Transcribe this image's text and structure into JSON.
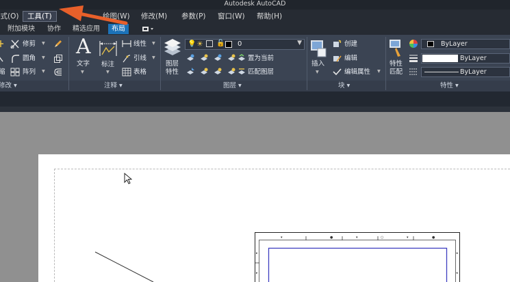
{
  "window": {
    "title": "Autodesk AutoCAD"
  },
  "menu": {
    "items": [
      {
        "label": "格式(O)"
      },
      {
        "label": "工具(T)"
      },
      {
        "label": "绘图(W)"
      },
      {
        "label": "修改(M)"
      },
      {
        "label": "参数(P)"
      },
      {
        "label": "窗口(W)"
      },
      {
        "label": "帮助(H)"
      }
    ]
  },
  "tabs": {
    "items": [
      {
        "label": "附加模块"
      },
      {
        "label": "协作"
      },
      {
        "label": "精选应用"
      },
      {
        "label": "布局"
      }
    ]
  },
  "ribbon": {
    "modify": {
      "title": "修改",
      "trim": "修剪",
      "fillet": "圆角",
      "array": "阵列"
    },
    "annotation": {
      "title": "注释",
      "text": "文字",
      "dimension": "标注",
      "linear": "线性",
      "leader": "引线",
      "table": "表格"
    },
    "layers": {
      "title": "图层",
      "layer_properties": "图层\n特性",
      "current_layer": "0",
      "make_current": "置为当前",
      "match_layer": "匹配图层"
    },
    "block": {
      "title": "块",
      "insert": "插入",
      "create": "创建",
      "edit": "编辑",
      "edit_attributes": "编辑属性"
    },
    "properties": {
      "title": "特性",
      "match_properties": "特性\n匹配",
      "color": "ByLayer",
      "linetype": "ByLayer",
      "lineweight": "ByLayer"
    }
  },
  "colors": {
    "accent": "#1c72b8",
    "arrow": "#e8602a",
    "viewport_border": "#3e3ec0"
  }
}
